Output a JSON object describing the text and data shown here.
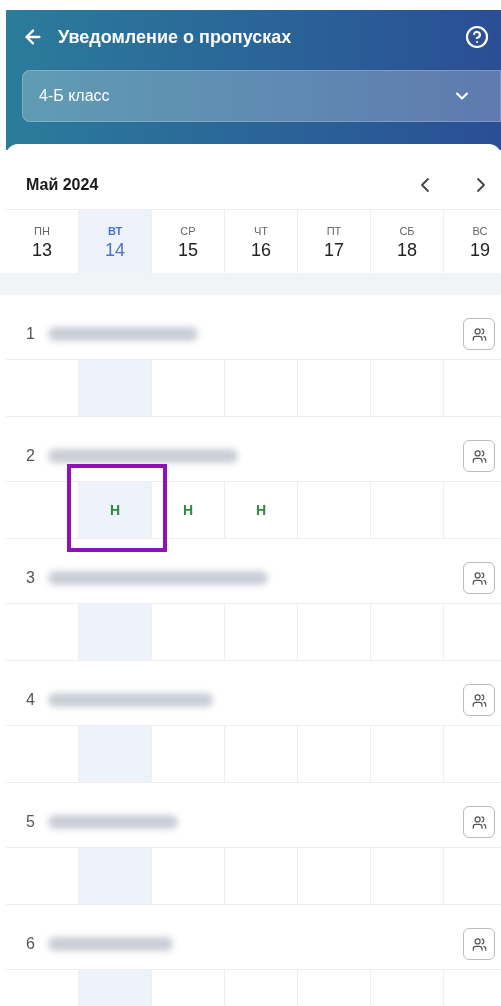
{
  "header": {
    "title": "Уведомление о пропусках",
    "class_select": {
      "value": "4-Б класс"
    }
  },
  "calendar": {
    "month": "Май 2024",
    "days": [
      {
        "weekday": "ПН",
        "date": "13",
        "selected": false
      },
      {
        "weekday": "ВТ",
        "date": "14",
        "selected": true
      },
      {
        "weekday": "СР",
        "date": "15",
        "selected": false
      },
      {
        "weekday": "ЧТ",
        "date": "16",
        "selected": false
      },
      {
        "weekday": "ПТ",
        "date": "17",
        "selected": false
      },
      {
        "weekday": "СБ",
        "date": "18",
        "selected": false
      },
      {
        "weekday": "ВС",
        "date": "19",
        "selected": false
      }
    ]
  },
  "students": [
    {
      "number": "1",
      "cells": [
        {},
        {},
        {},
        {},
        {},
        {},
        {}
      ]
    },
    {
      "number": "2",
      "cells": [
        {},
        {
          "mark": "Н",
          "highlighted": true
        },
        {
          "mark": "Н",
          "highlighted": false
        },
        {
          "mark": "Н",
          "highlighted": false
        },
        {},
        {},
        {}
      ]
    },
    {
      "number": "3",
      "cells": [
        {},
        {},
        {},
        {},
        {},
        {},
        {}
      ]
    },
    {
      "number": "4",
      "cells": [
        {},
        {},
        {},
        {},
        {},
        {},
        {}
      ]
    },
    {
      "number": "5",
      "cells": [
        {},
        {},
        {},
        {},
        {},
        {},
        {}
      ]
    },
    {
      "number": "6",
      "cells": [
        {},
        {},
        {},
        {},
        {},
        {},
        {}
      ]
    }
  ]
}
